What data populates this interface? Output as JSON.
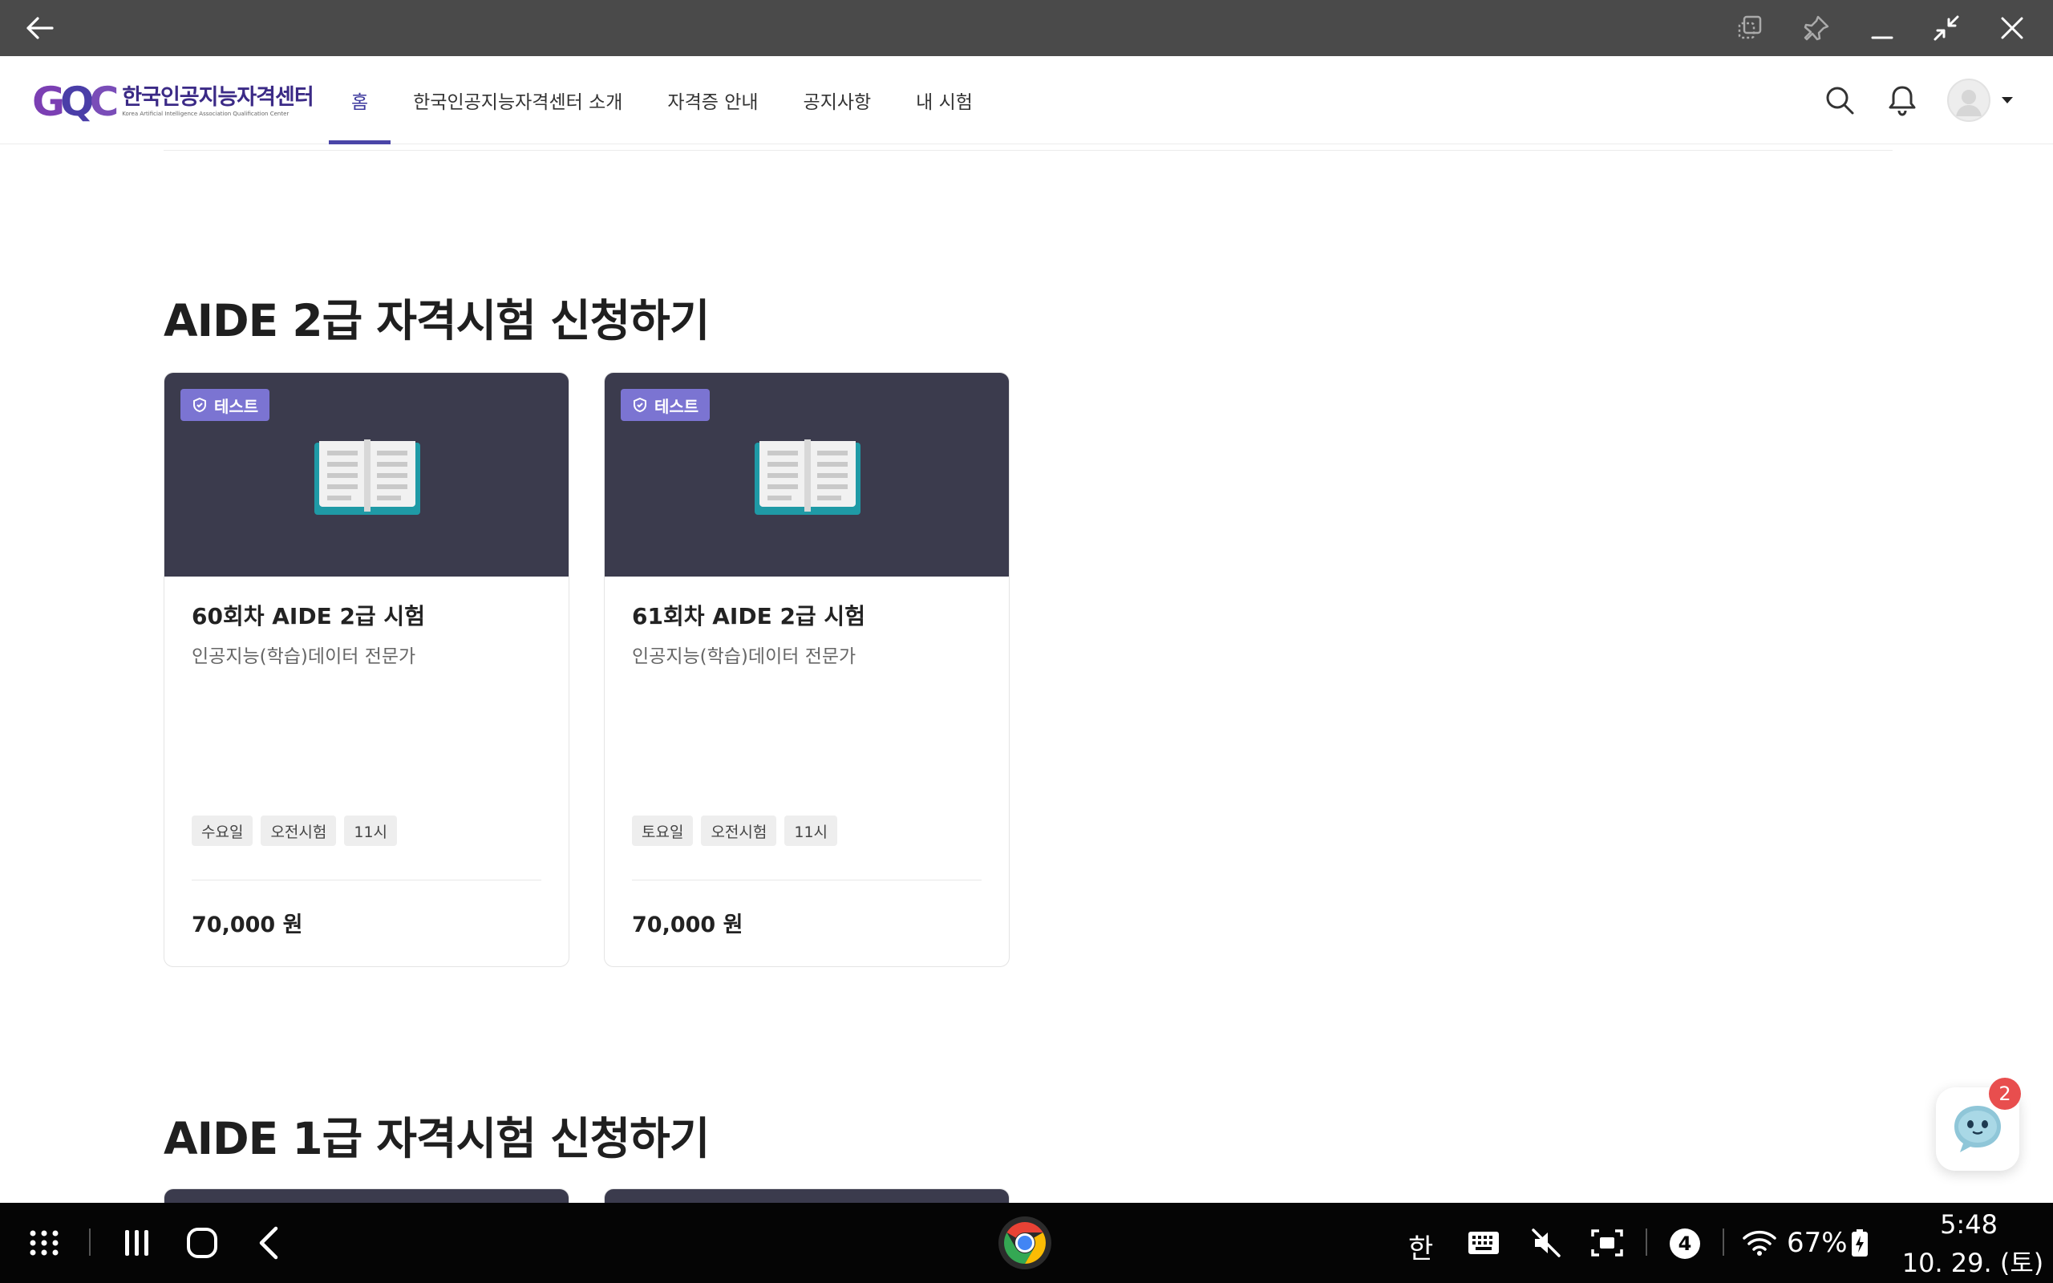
{
  "header": {
    "logo_mark": "GQC",
    "logo_title": "한국인공지능자격센터",
    "logo_subtitle": "Korea Artificial Intelligence Association Qualification Center",
    "nav": [
      {
        "label": "홈"
      },
      {
        "label": "한국인공지능자격센터 소개"
      },
      {
        "label": "자격증 안내"
      },
      {
        "label": "공지사항"
      },
      {
        "label": "내 시험"
      }
    ]
  },
  "sections": [
    {
      "title": "AIDE 2급 자격시험 신청하기",
      "cards": [
        {
          "badge": "테스트",
          "title": "60회차 AIDE 2급 시험",
          "subtitle": "인공지능(학습)데이터 전문가",
          "chips": [
            "수요일",
            "오전시험",
            "11시"
          ],
          "price": "70,000 원"
        },
        {
          "badge": "테스트",
          "title": "61회차 AIDE 2급 시험",
          "subtitle": "인공지능(학습)데이터 전문가",
          "chips": [
            "토요일",
            "오전시험",
            "11시"
          ],
          "price": "70,000 원"
        }
      ]
    },
    {
      "title": "AIDE 1급 자격시험 신청하기"
    }
  ],
  "chat": {
    "badge_count": "2"
  },
  "system_bar": {
    "ime": "한",
    "notification_count": "4",
    "battery": "67%",
    "time": "5:48",
    "date": "10. 29. (토)"
  },
  "colors": {
    "accent": "#4a45a8",
    "thumb_bg": "#3b3b4d",
    "badge_bg": "#7b74d2",
    "chat_badge": "#e84e4e"
  }
}
